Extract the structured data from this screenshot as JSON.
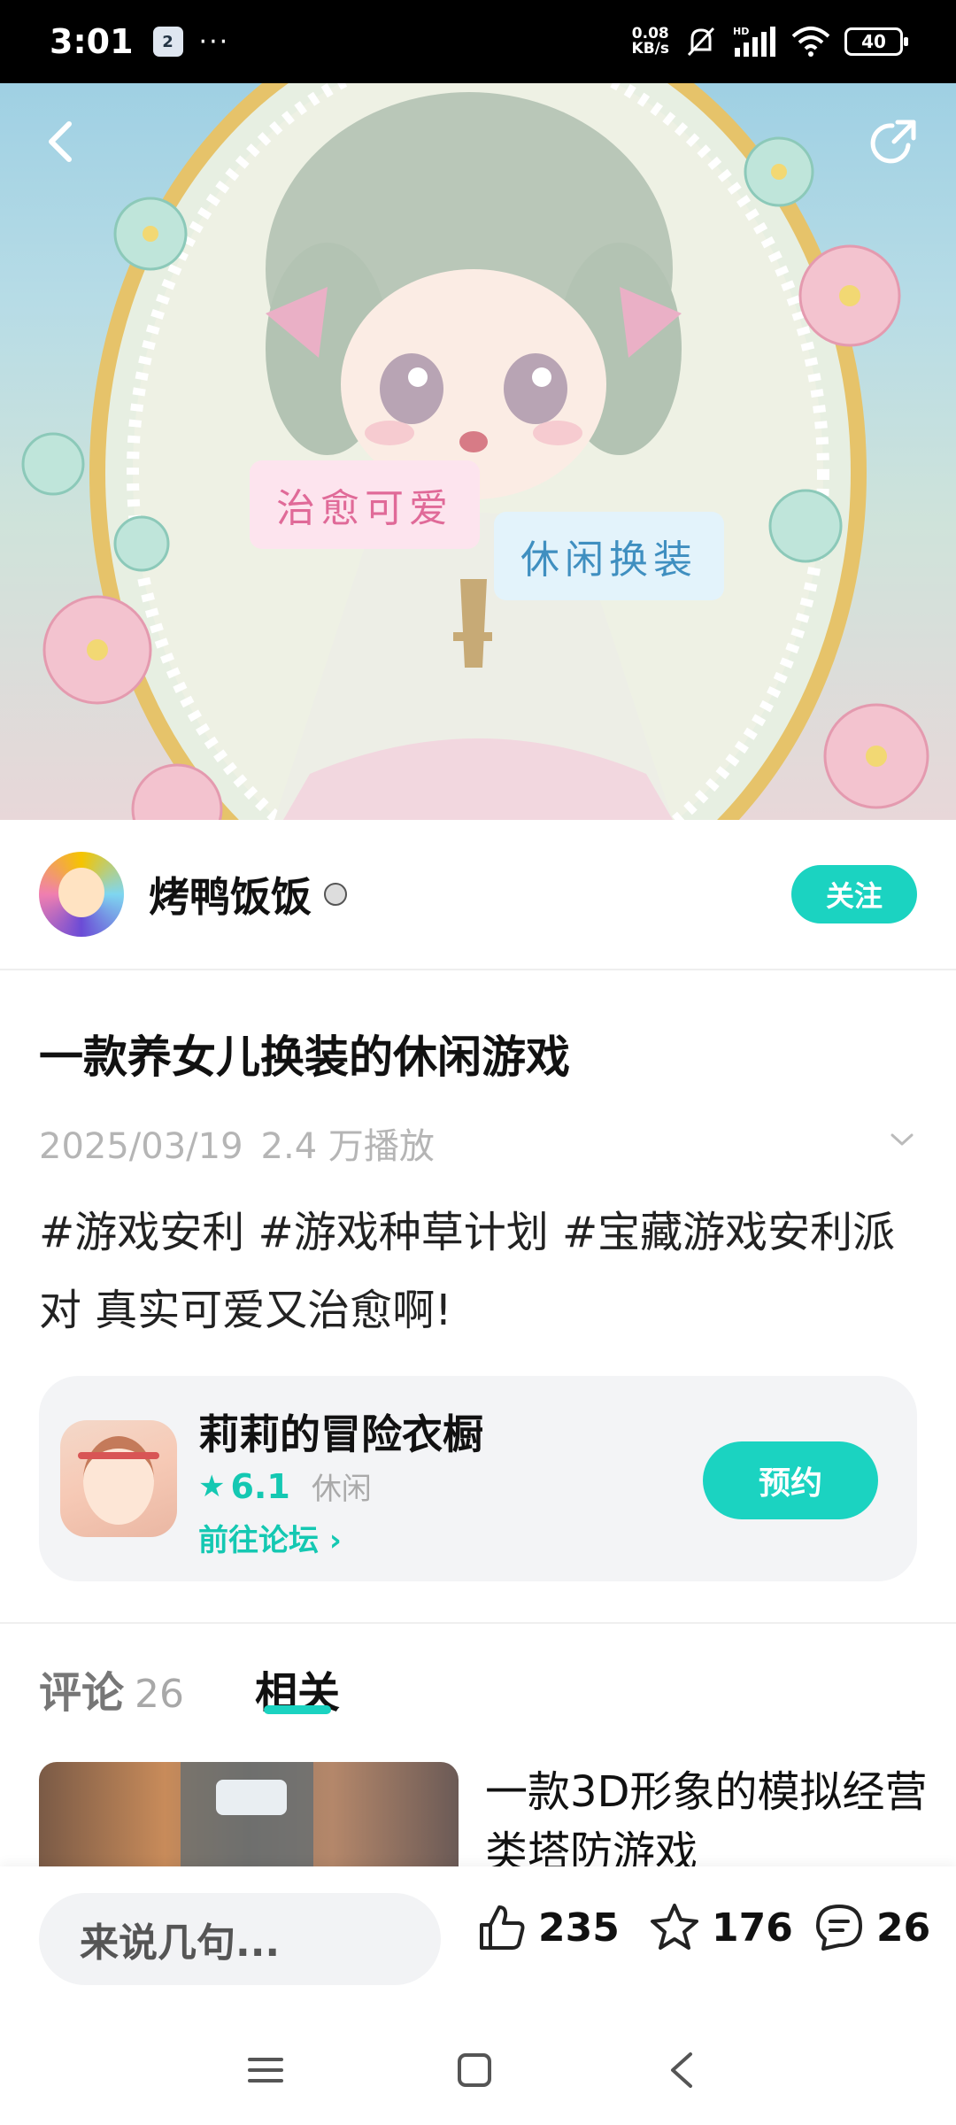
{
  "status_bar": {
    "time": "3:01",
    "notif_badge": "2",
    "more": "···",
    "net_speed_value": "0.08",
    "net_speed_unit": "KB/s",
    "battery": "40",
    "icons": [
      "mute-icon",
      "signal-icon",
      "wifi-icon",
      "battery-icon"
    ]
  },
  "hero": {
    "tag1": "治愈可爱",
    "tag2": "休闲换装"
  },
  "author": {
    "name": "烤鸭饭饭",
    "follow_label": "关注"
  },
  "post": {
    "title": "一款养女儿换装的休闲游戏",
    "date": "2025/03/19",
    "plays": "2.4 万播放",
    "body": "#游戏安利 #游戏种草计划 #宝藏游戏安利派对 真实可爱又治愈啊!"
  },
  "game_card": {
    "name": "莉莉的冒险衣橱",
    "rating": "6.1",
    "genre": "休闲",
    "forum_link": "前往论坛 ›",
    "reserve_label": "预约"
  },
  "tabs": {
    "comments_label": "评论",
    "comments_count": "26",
    "related_label": "相关"
  },
  "related": {
    "title": "一款3D形象的模拟经营类塔防游戏"
  },
  "bottom_bar": {
    "input_placeholder": "来说几句...",
    "likes": "235",
    "favorites": "176",
    "comments": "26"
  },
  "colors": {
    "accent": "#1bd3c1",
    "accent_text": "#14c8b2"
  }
}
